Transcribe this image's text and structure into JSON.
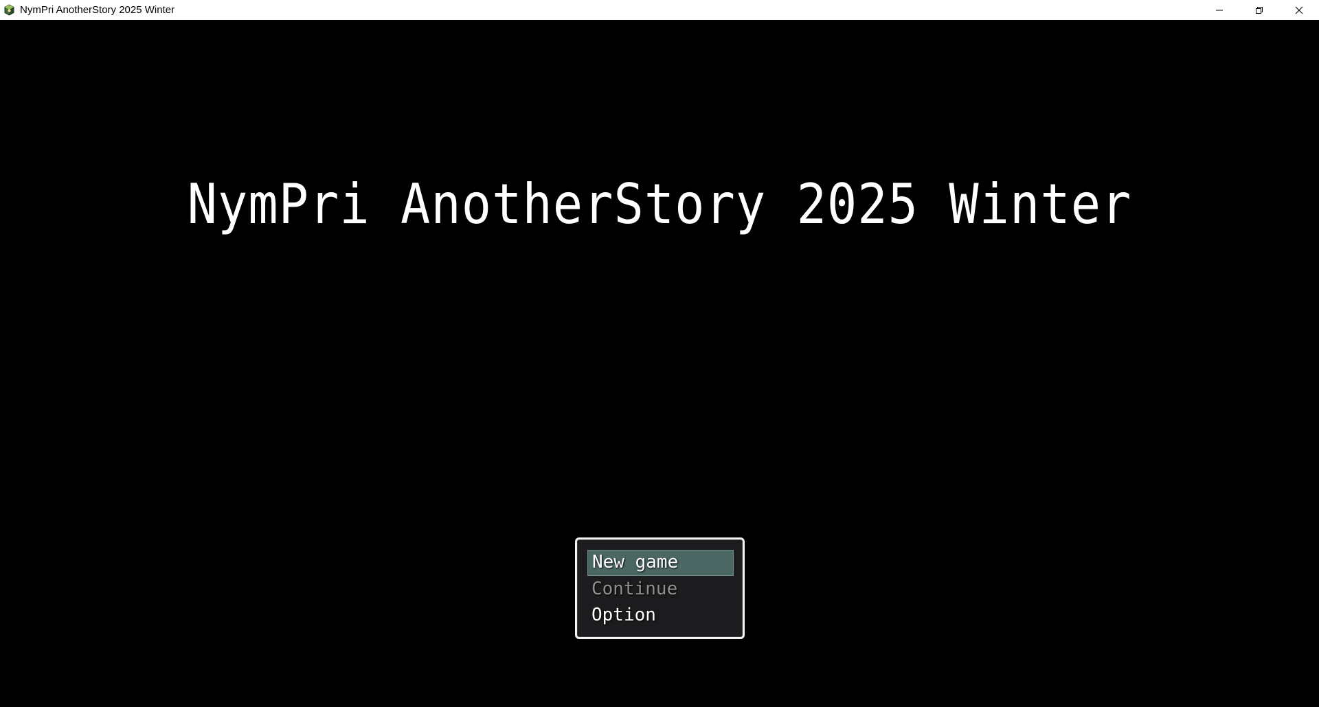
{
  "window": {
    "title": "NymPri AnotherStory 2025 Winter",
    "icon": "app-icon",
    "controls": {
      "minimize_icon": "minimize-icon",
      "restore_icon": "restore-icon",
      "close_icon": "close-icon"
    }
  },
  "game": {
    "title": "NymPri AnotherStory 2025 Winter",
    "background_color": "#000000",
    "menu": {
      "items": [
        {
          "label": "New game",
          "state": "selected"
        },
        {
          "label": "Continue",
          "state": "disabled"
        },
        {
          "label": "Option",
          "state": "enabled"
        }
      ],
      "selection_color": "#4b6763",
      "frame_color": "#f4f4f4"
    }
  }
}
